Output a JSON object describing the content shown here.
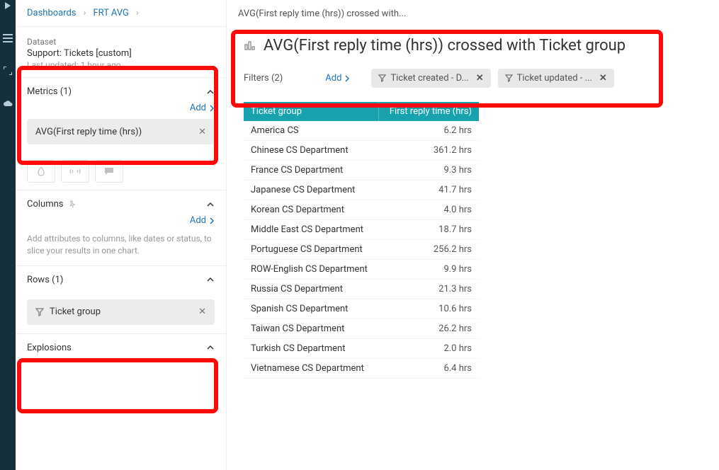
{
  "breadcrumb": {
    "dashboards": "Dashboards",
    "frt_avg": "FRT AVG",
    "current": "AVG(First reply time (hrs)) crossed with..."
  },
  "dataset": {
    "label": "Dataset",
    "name": "Support: Tickets [custom]",
    "updated": "Last updated: 1 hour ago"
  },
  "metrics": {
    "title": "Metrics (1)",
    "add": "Add",
    "chip": "AVG(First reply time (hrs))"
  },
  "columns": {
    "title": "Columns",
    "add": "Add",
    "hint": "Add attributes to columns, like dates or status, to slice your results in one chart."
  },
  "rows": {
    "title": "Rows (1)",
    "chip": "Ticket group"
  },
  "explosions": {
    "title": "Explosions"
  },
  "main": {
    "title": "AVG(First reply time (hrs)) crossed with Ticket group"
  },
  "filters": {
    "label": "Filters (2)",
    "add": "Add",
    "chips": [
      "Ticket created - D...",
      "Ticket updated - ..."
    ]
  },
  "chart_data": {
    "type": "table",
    "columns": [
      "Ticket group",
      "First reply time (hrs)"
    ],
    "unit_suffix": " hrs",
    "rows": [
      {
        "group": "America CS",
        "value": 6.2
      },
      {
        "group": "Chinese CS Department",
        "value": 361.2
      },
      {
        "group": "France CS Department",
        "value": 9.3
      },
      {
        "group": "Japanese CS Department",
        "value": 41.7
      },
      {
        "group": "Korean CS Department",
        "value": 4.0
      },
      {
        "group": "Middle East CS Department",
        "value": 18.7
      },
      {
        "group": "Portuguese CS Department",
        "value": 256.2
      },
      {
        "group": "ROW-English CS Department",
        "value": 9.9
      },
      {
        "group": "Russia CS Department",
        "value": 21.3
      },
      {
        "group": "Spanish CS Department",
        "value": 10.6
      },
      {
        "group": "Taiwan CS Department",
        "value": 26.2
      },
      {
        "group": "Turkish CS Department",
        "value": 2.0
      },
      {
        "group": "Vietnamese CS Department",
        "value": 6.4
      }
    ]
  }
}
